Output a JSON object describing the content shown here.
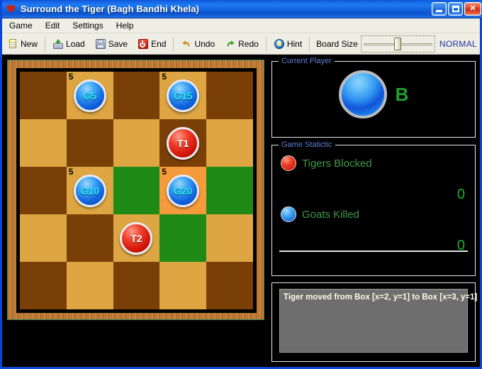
{
  "window": {
    "title": "Surround the Tiger (Bagh Bandhi Khela)",
    "app_icon": "tiger-paw-icon",
    "minimize_label": "",
    "maximize_label": "",
    "close_label": "✕"
  },
  "menubar": {
    "items": [
      {
        "label": "Game"
      },
      {
        "label": "Edit"
      },
      {
        "label": "Settings"
      },
      {
        "label": "Help"
      }
    ]
  },
  "toolbar": {
    "buttons": [
      {
        "label": "New",
        "icon": "new-page-icon"
      },
      {
        "label": "Load",
        "icon": "folder-open-icon"
      },
      {
        "label": "Save",
        "icon": "floppy-disk-icon"
      },
      {
        "label": "End",
        "icon": "power-off-icon"
      },
      {
        "label": "Undo",
        "icon": "undo-arrow-icon"
      },
      {
        "label": "Redo",
        "icon": "redo-arrow-icon"
      },
      {
        "label": "Hint",
        "icon": "lightbulb-globe-icon"
      }
    ],
    "board_size_label": "Board Size",
    "board_size_mode": "NORMAL",
    "board_size_percent": 50
  },
  "board": {
    "rows": 5,
    "cols": 5,
    "cells": [
      [
        {
          "shade": "dark",
          "piece": null,
          "count": null
        },
        {
          "shade": "light",
          "piece": {
            "type": "goat",
            "label": "G5"
          },
          "count": "5"
        },
        {
          "shade": "dark",
          "piece": null,
          "count": null
        },
        {
          "shade": "light",
          "piece": {
            "type": "goat",
            "label": "G15"
          },
          "count": "5"
        },
        {
          "shade": "dark",
          "piece": null,
          "count": null
        }
      ],
      [
        {
          "shade": "light",
          "piece": null,
          "count": null
        },
        {
          "shade": "dark",
          "piece": null,
          "count": null
        },
        {
          "shade": "light",
          "piece": null,
          "count": null
        },
        {
          "shade": "dark",
          "piece": {
            "type": "tiger",
            "label": "T1"
          },
          "count": null
        },
        {
          "shade": "light",
          "piece": null,
          "count": null
        }
      ],
      [
        {
          "shade": "dark",
          "piece": null,
          "count": null
        },
        {
          "shade": "light",
          "piece": {
            "type": "goat",
            "label": "G10"
          },
          "count": "5"
        },
        {
          "shade": "green",
          "piece": null,
          "count": null
        },
        {
          "shade": "sel",
          "piece": {
            "type": "goat",
            "label": "G20"
          },
          "count": "5"
        },
        {
          "shade": "green",
          "piece": null,
          "count": null
        }
      ],
      [
        {
          "shade": "light",
          "piece": null,
          "count": null
        },
        {
          "shade": "dark",
          "piece": null,
          "count": null
        },
        {
          "shade": "light",
          "piece": {
            "type": "tiger",
            "label": "T2"
          },
          "count": null
        },
        {
          "shade": "green",
          "piece": null,
          "count": null
        },
        {
          "shade": "light",
          "piece": null,
          "count": null
        }
      ],
      [
        {
          "shade": "dark",
          "piece": null,
          "count": null
        },
        {
          "shade": "light",
          "piece": null,
          "count": null
        },
        {
          "shade": "dark",
          "piece": null,
          "count": null
        },
        {
          "shade": "light",
          "piece": null,
          "count": null
        },
        {
          "shade": "dark",
          "piece": null,
          "count": null
        }
      ]
    ]
  },
  "current_player": {
    "group_label": "Current Player",
    "letter": "B",
    "token": "blue-ball-icon"
  },
  "game_statistic": {
    "group_label": "Game Statictic",
    "rows": [
      {
        "icon": "red-ball-icon",
        "label": "Tigers Blocked",
        "value": "0"
      },
      {
        "icon": "blue-ball-icon",
        "label": "Goats Killed",
        "value": "0"
      }
    ]
  },
  "log": {
    "message": "Tiger moved from Box [x=2, y=1] to Box [x=3, y=1]"
  },
  "colors": {
    "titlebar_blue": "#1565e6",
    "cell_dark": "#7a3f07",
    "cell_light": "#dda643",
    "cell_green": "#1f8a16",
    "cell_selected": "#f59b3c",
    "goat_blue": "#1267e0",
    "tiger_red": "#cf1206",
    "stat_label_green": "#3f9a4a",
    "stat_value_green": "#19b32a",
    "group_label_blue": "#5f7fd8",
    "board_frame_wood": "#c8813a"
  }
}
